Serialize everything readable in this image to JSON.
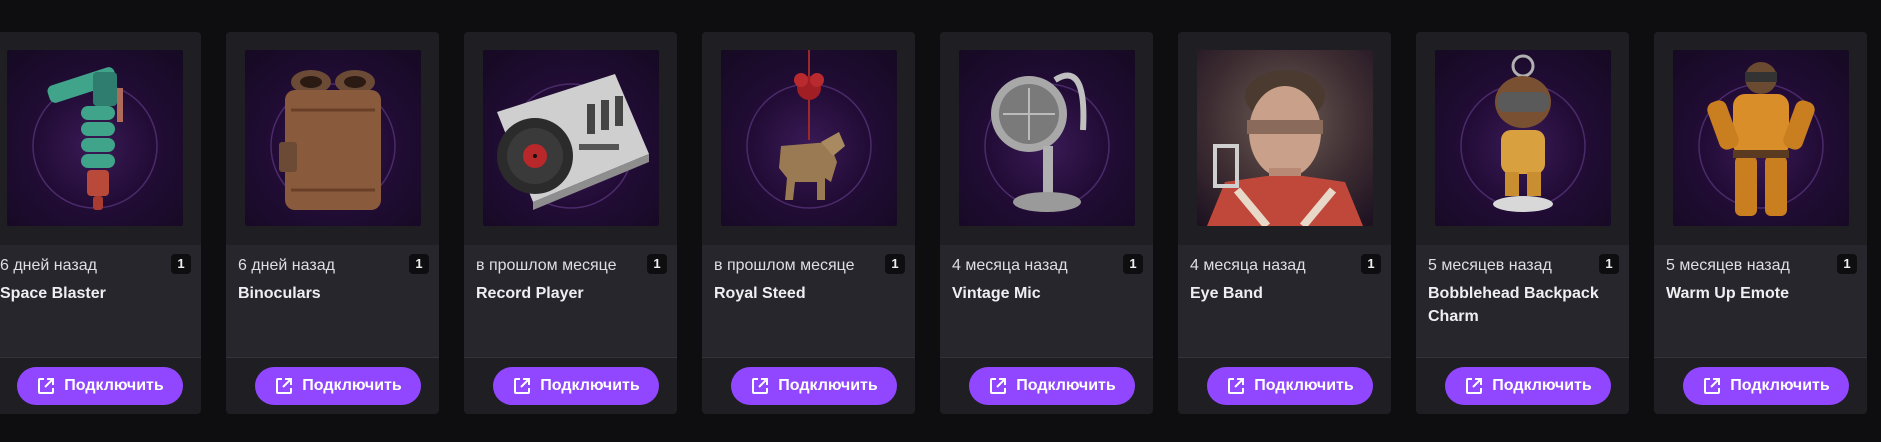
{
  "colors": {
    "accent": "#9147ff",
    "card_bg": "#1f1f23",
    "page_bg": "#0e0e10"
  },
  "cards": [
    {
      "ago": "6 дней назад",
      "qty": "1",
      "name": "Space Blaster",
      "button": "Подключить",
      "icon": "space-blaster-icon"
    },
    {
      "ago": "6 дней назад",
      "qty": "1",
      "name": "Binoculars",
      "button": "Подключить",
      "icon": "binoculars-icon"
    },
    {
      "ago": "в прошлом месяце",
      "qty": "1",
      "name": "Record Player",
      "button": "Подключить",
      "icon": "record-player-icon"
    },
    {
      "ago": "в прошлом месяце",
      "qty": "1",
      "name": "Royal Steed",
      "button": "Подключить",
      "icon": "royal-steed-icon"
    },
    {
      "ago": "4 месяца назад",
      "qty": "1",
      "name": "Vintage Mic",
      "button": "Подключить",
      "icon": "vintage-mic-icon"
    },
    {
      "ago": "4 месяца назад",
      "qty": "1",
      "name": "Eye Band",
      "button": "Подключить",
      "icon": "eye-band-icon"
    },
    {
      "ago": "5 месяцев назад",
      "qty": "1",
      "name": "Bobblehead Backpack Charm",
      "button": "Подключить",
      "icon": "bobblehead-icon"
    },
    {
      "ago": "5 месяцев назад",
      "qty": "1",
      "name": "Warm Up Emote",
      "button": "Подключить",
      "icon": "warm-up-emote-icon"
    }
  ]
}
